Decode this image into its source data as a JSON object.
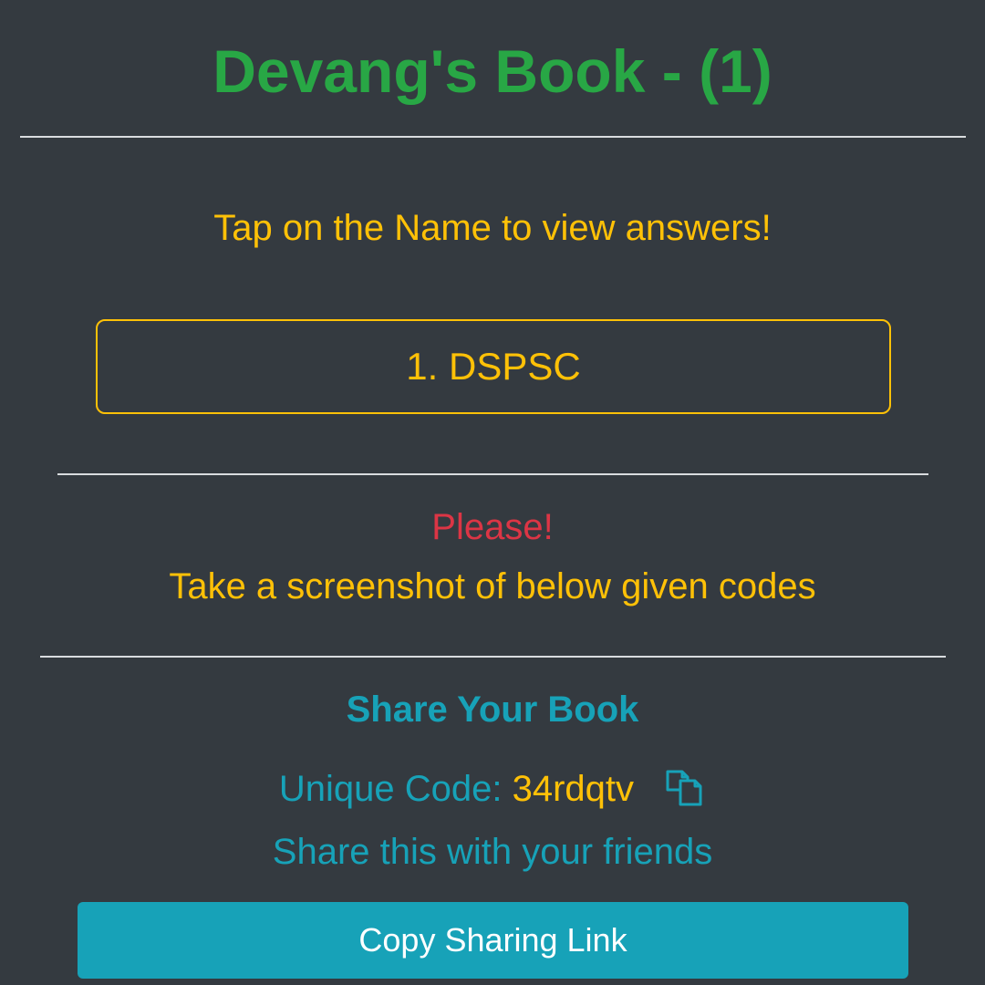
{
  "header": {
    "title": "Devang's Book - (1)"
  },
  "instruction": "Tap on the Name to view answers!",
  "names": [
    {
      "label": "1. DSPSC"
    }
  ],
  "notice": {
    "please": "Please!",
    "message": "Take a screenshot of below given codes"
  },
  "share": {
    "heading": "Share Your Book",
    "code_label": "Unique Code:",
    "code_value": "34rdqtv",
    "copy_icon": "copy-icon",
    "friends_text": "Share this with your friends",
    "button_label": "Copy Sharing Link"
  },
  "colors": {
    "background": "#343a40",
    "title": "#28a745",
    "accent_yellow": "#ffc107",
    "accent_red": "#dc3545",
    "accent_teal": "#17a2b8"
  }
}
